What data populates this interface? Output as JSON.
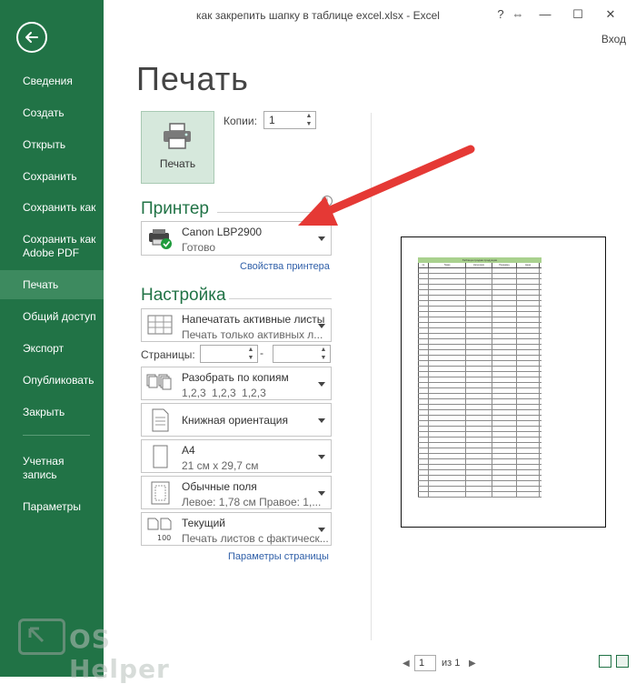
{
  "window": {
    "title": "как закрепить шапку в таблице excel.xlsx - Excel",
    "help": "?",
    "restore": "⇔",
    "minimize": "—",
    "maximize": "☐",
    "close": "✕",
    "signin": "Вход"
  },
  "sidebar": {
    "items": [
      {
        "label": "Сведения"
      },
      {
        "label": "Создать"
      },
      {
        "label": "Открыть"
      },
      {
        "label": "Сохранить"
      },
      {
        "label": "Сохранить как"
      },
      {
        "label": "Сохранить как Adobe PDF"
      },
      {
        "label": "Печать"
      },
      {
        "label": "Общий доступ"
      },
      {
        "label": "Экспорт"
      },
      {
        "label": "Опубликовать"
      },
      {
        "label": "Закрыть"
      },
      {
        "label": "Учетная запись"
      },
      {
        "label": "Параметры"
      }
    ],
    "active_index": 6,
    "color": "#217346"
  },
  "watermark": {
    "text": "OS Helper"
  },
  "print": {
    "page_title": "Печать",
    "print_button": "Печать",
    "copies_label": "Копии:",
    "copies_value": "1"
  },
  "printer": {
    "section": "Принтер",
    "name": "Canon LBP2900",
    "status": "Готово",
    "properties_link": "Свойства принтера"
  },
  "settings": {
    "section": "Настройка",
    "scope": {
      "title": "Напечатать активные листы",
      "subtitle": "Печать только активных л..."
    },
    "pages_label": "Страницы:",
    "pages_dash": "-",
    "collate": {
      "title": "Разобрать по копиям",
      "subtitle": "1,2,3    1,2,3    1,2,3"
    },
    "orientation": {
      "title": "Книжная ориентация"
    },
    "paper": {
      "title": "A4",
      "subtitle": "21 см x 29,7 см"
    },
    "margins": {
      "title": "Обычные поля",
      "subtitle": "Левое:  1,78 см    Правое:  1,..."
    },
    "scaling": {
      "title": "Текущий",
      "subtitle": "Печать листов с фактическ..."
    },
    "page_setup_link": "Параметры страницы"
  },
  "preview": {
    "sheet_title": "Таблица продаж продукции",
    "columns": [
      "№",
      "Товар",
      "Категория",
      "Продавец",
      "Цена"
    ],
    "page_current": "1",
    "page_of": "из 1",
    "prev": "◀",
    "next": "▶"
  }
}
